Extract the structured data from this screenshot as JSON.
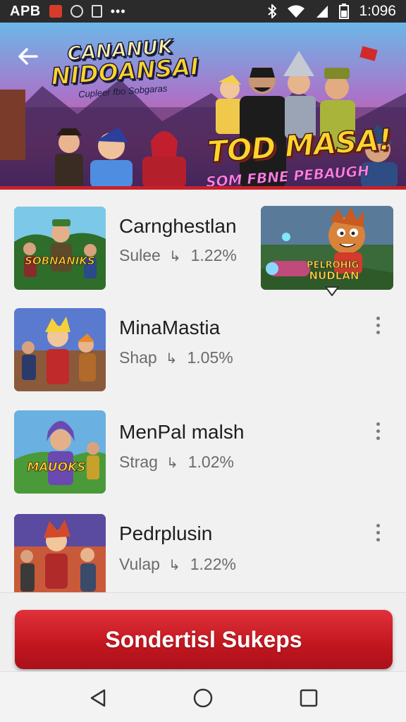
{
  "status_bar": {
    "carrier": "APB",
    "time": "1:096"
  },
  "banner": {
    "title_line1": "CANANUK",
    "title_line2": "NIDOANSAI",
    "subtitle": "Cupleer fbo Sobgaras",
    "headline": "TOD MASA!",
    "tagline": "SOM FBNE PEBAUGH"
  },
  "items": [
    {
      "title": "Carnghestlan",
      "meta_label": "Sulee",
      "meta_value": "1.22%",
      "thumb_text": "SOBNANIKS"
    },
    {
      "title": "MinaMastia",
      "meta_label": "Shap",
      "meta_value": "1.05%"
    },
    {
      "title": "MenPal malsh",
      "meta_label": "Strag",
      "meta_value": "1.02%",
      "thumb_text": "MAUOKS"
    },
    {
      "title": "Pedrplusin",
      "meta_label": "Vulap",
      "meta_value": "1.22%"
    }
  ],
  "side_thumb": {
    "line1": "PELROHIG",
    "line2": "NUDLAN"
  },
  "cta": {
    "label": "Sondertisl Sukeps"
  },
  "icons": {
    "back": "back-arrow-icon",
    "more": "more-vert-icon",
    "nav_back": "triangle-back-icon",
    "nav_home": "circle-home-icon",
    "nav_recents": "square-recents-icon"
  },
  "colors": {
    "accent": "#c9202a",
    "cta": "#c2161f"
  }
}
